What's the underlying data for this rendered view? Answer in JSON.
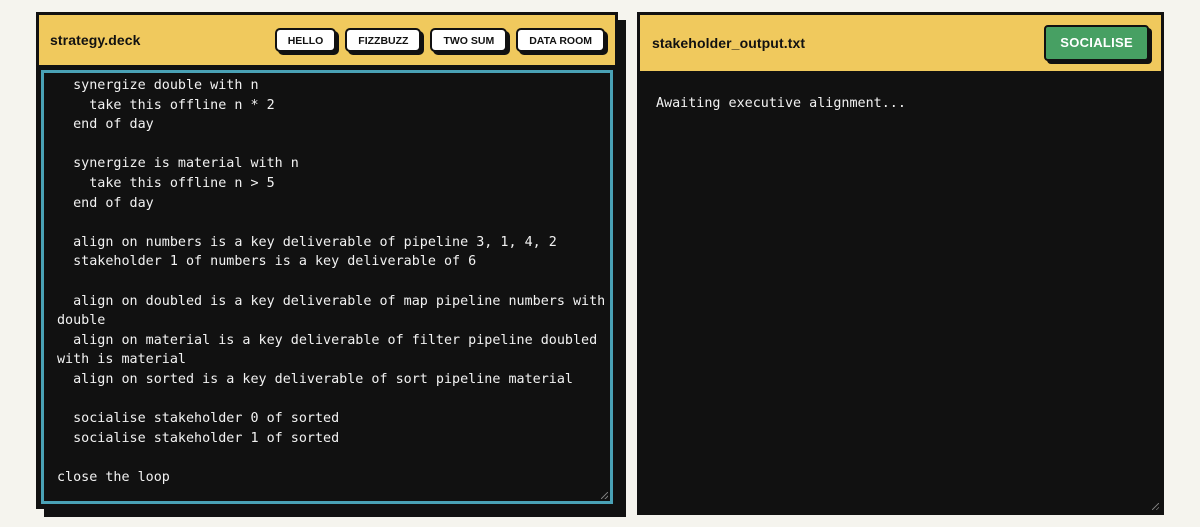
{
  "editor_panel": {
    "title": "strategy.deck",
    "buttons": [
      "HELLO",
      "FIZZBUZZ",
      "TWO SUM",
      "DATA ROOM"
    ],
    "code": "  synergize double with n\n    take this offline n * 2\n  end of day\n\n  synergize is material with n\n    take this offline n > 5\n  end of day\n\n  align on numbers is a key deliverable of pipeline 3, 1, 4, 2\n  stakeholder 1 of numbers is a key deliverable of 6\n\n  align on doubled is a key deliverable of map pipeline numbers with\ndouble\n  align on material is a key deliverable of filter pipeline doubled\nwith is material\n  align on sorted is a key deliverable of sort pipeline material\n\n  socialise stakeholder 0 of sorted\n  socialise stakeholder 1 of sorted\n\nclose the loop"
  },
  "output_panel": {
    "title": "stakeholder_output.txt",
    "run_button": "SOCIALISE",
    "output_text": "Awaiting executive alignment..."
  },
  "colors": {
    "header_bg": "#f0c95d",
    "editor_border": "#4aa2b6",
    "run_button_bg": "#47a063",
    "panel_bg": "#111111"
  }
}
